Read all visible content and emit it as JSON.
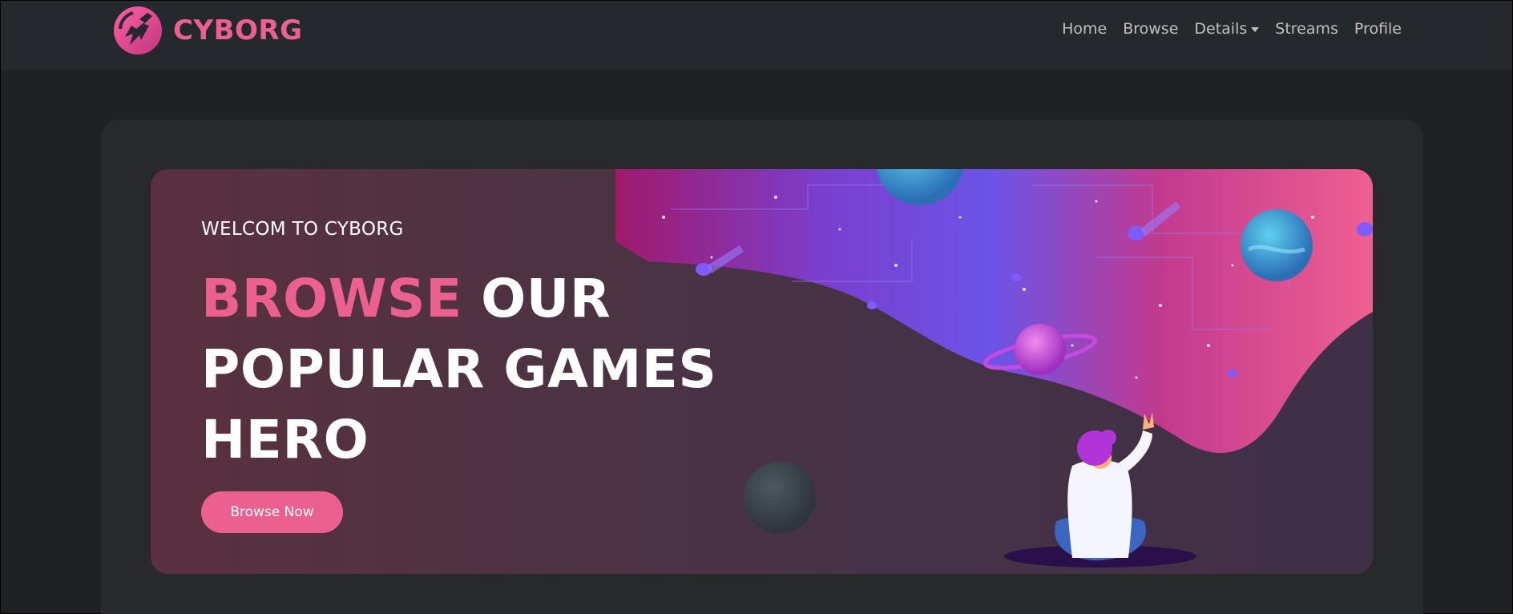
{
  "brand": {
    "name": "CYBORG",
    "icon": "cyborg-logo-icon",
    "color": "#ec6090"
  },
  "nav": {
    "items": [
      {
        "label": "Home"
      },
      {
        "label": "Browse"
      },
      {
        "label": "Details",
        "dropdown": true
      },
      {
        "label": "Streams"
      },
      {
        "label": "Profile"
      }
    ]
  },
  "banner": {
    "welcome": "WELCOM TO CYBORG",
    "headline_accent": "BROWSE",
    "headline_line1_rest": "OUR",
    "headline_line2": "POPULAR GAMES",
    "headline_line3": "HERO",
    "button_label": "Browse Now"
  },
  "colors": {
    "accent": "#ec6090",
    "background": "#1f2122",
    "header": "#25282c",
    "panel": "#27292a"
  }
}
